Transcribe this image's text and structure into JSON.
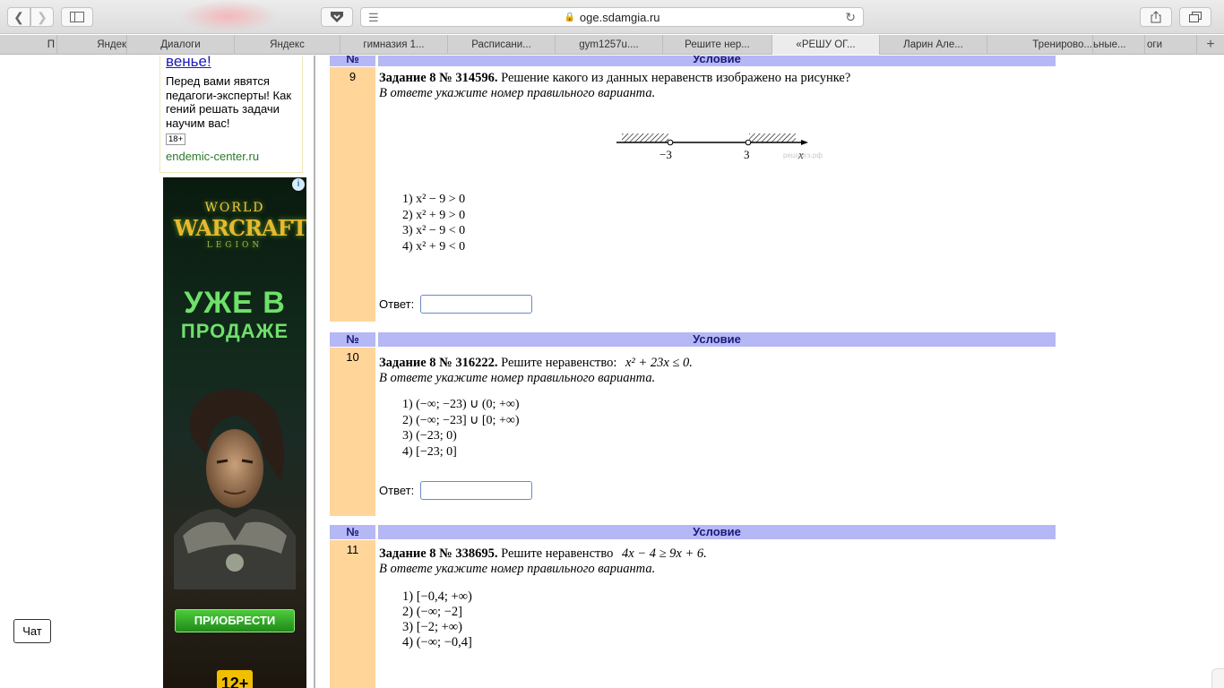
{
  "browser": {
    "url": "oge.sdamgia.ru",
    "tabs": [
      "П",
      "Яндек",
      "Диалоги",
      "Яндекс",
      "гимназия 1...",
      "Расписани...",
      "gym1257u....",
      "Решите нер...",
      "«РЕШУ ОГ...",
      "Ларин Але...",
      "Тренирово...",
      "ьные...",
      "оги"
    ],
    "active_tab_index": 8,
    "new_tab": "+"
  },
  "ad_text": {
    "headline": "венье!",
    "body": "Перед вами явятся педагоги-эксперты! Как гений решать задачи научим вас!",
    "age": "18+",
    "domain": "endemic-center.ru"
  },
  "ad_banner": {
    "info": "i",
    "logo_line1": "WORLD",
    "logo_line2": "WARCRAFT",
    "logo_line3": "LEGION",
    "slogan_line1": "УЖЕ В",
    "slogan_line2": "ПРОДАЖЕ",
    "buy_label": "ПРИОБРЕСТИ",
    "rating": "12+"
  },
  "headers": {
    "no": "№",
    "cond": "Условие"
  },
  "tasks": [
    {
      "number": "9",
      "title": "Задание 8 № 314596.",
      "question": "Решение какого из данных неравенств изображено на рисунке?",
      "note": "В ответе укажите номер правильного варианта.",
      "figure": {
        "left_label": "−3",
        "right_label": "3",
        "axis_label": "x",
        "watermark": "решуогэ.рф"
      },
      "options": [
        "1)  x² − 9 > 0",
        "2)  x² + 9 > 0",
        "3)  x² − 9 < 0",
        "4)  x² + 9 < 0"
      ],
      "answer_label": "Ответ:"
    },
    {
      "number": "10",
      "title": "Задание 8 № 316222.",
      "question": "Решите неравенство:",
      "math": "x² + 23x ≤ 0.",
      "note": "В ответе укажите номер правильного варианта.",
      "options": [
        "1)  (−∞; −23) ∪ (0; +∞)",
        "2)  (−∞; −23] ∪ [0; +∞)",
        "3)  (−23; 0)",
        "4)  [−23; 0]"
      ],
      "answer_label": "Ответ:"
    },
    {
      "number": "11",
      "title": "Задание 8 № 338695.",
      "question": "Решите неравенство",
      "math": "4x − 4 ≥ 9x + 6.",
      "note": "В ответе укажите номер правильного варианта.",
      "options": [
        "1) [−0,4; +∞)",
        "2) (−∞; −2]",
        "3) [−2; +∞)",
        "4) (−∞; −0,4]"
      ]
    }
  ],
  "chat_label": "Чат"
}
